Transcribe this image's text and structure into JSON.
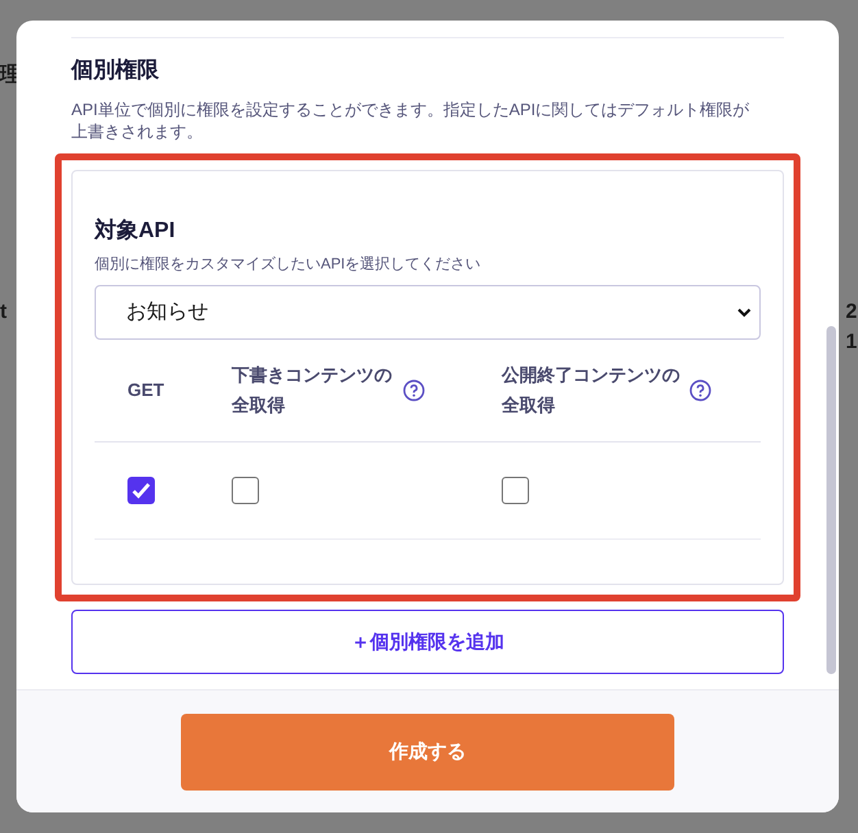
{
  "background": {
    "left_fragments": [
      "理",
      "t"
    ],
    "right_fragments": [
      "2",
      "1"
    ]
  },
  "section": {
    "title": "個別権限",
    "description": "API単位で個別に権限を設定することができます。指定したAPIに関してはデフォルト権限が上書きされます。"
  },
  "permission": {
    "highlighted": true,
    "label": "対象API",
    "hint": "個別に権限をカスタマイズしたいAPIを選択してください",
    "selected_api": "お知らせ",
    "columns": [
      {
        "label": "GET",
        "help": false,
        "checked": true
      },
      {
        "label": "下書きコンテンツの全取得",
        "help": true,
        "checked": false
      },
      {
        "label": "公開終了コンテンツの全取得",
        "help": true,
        "checked": false
      }
    ]
  },
  "add_button": "＋個別権限を追加",
  "submit_button": "作成する"
}
